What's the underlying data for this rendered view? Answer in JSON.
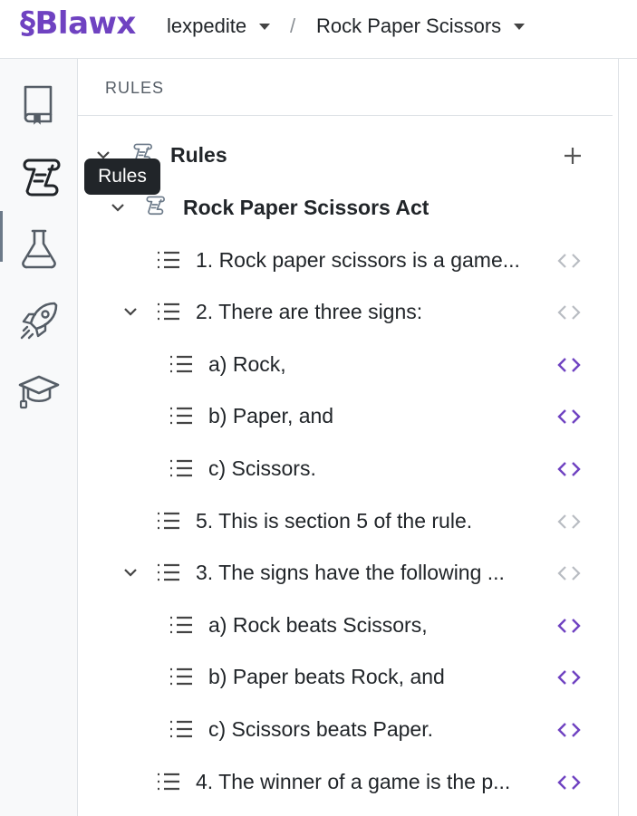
{
  "header": {
    "logo": "§Blawx",
    "workspace": "lexpedite",
    "separator": "/",
    "project": "Rock Paper Scissors"
  },
  "sidebar": {
    "items": [
      {
        "icon": "book-icon",
        "active": false
      },
      {
        "icon": "scroll-icon",
        "active": true
      },
      {
        "icon": "flask-icon",
        "active": false
      },
      {
        "icon": "rocket-icon",
        "active": false
      },
      {
        "icon": "graduation-cap-icon",
        "active": false
      }
    ],
    "tooltip": "Rules"
  },
  "panel": {
    "title": "RULES",
    "add_icon": "plus-icon"
  },
  "tree": {
    "root": "Rules",
    "act": "Rock Paper Scissors Act",
    "items": [
      {
        "label": "1. Rock paper scissors is a game..."
      },
      {
        "label": "2. There are three signs:"
      },
      {
        "label": "a) Rock,"
      },
      {
        "label": "b) Paper, and"
      },
      {
        "label": "c) Scissors."
      },
      {
        "label": "5. This is section 5 of the rule."
      },
      {
        "label": "3. The signs have the following ..."
      },
      {
        "label": "a) Rock beats Scissors,"
      },
      {
        "label": "b) Paper beats Rock, and"
      },
      {
        "label": "c) Scissors beats Paper."
      },
      {
        "label": "4. The winner of a game is the p..."
      }
    ]
  },
  "colors": {
    "brand": "#6f42c1",
    "code_active": "#6f42c1",
    "code_inactive": "#b8bcc2",
    "tooltip_bg": "#212529"
  }
}
